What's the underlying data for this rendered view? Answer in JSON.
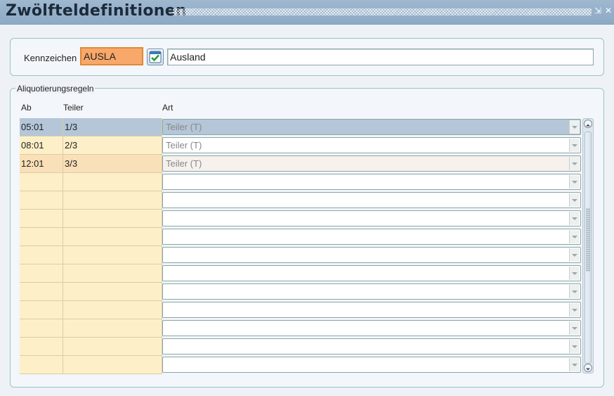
{
  "window": {
    "title": "Zwölfteldefinitionen",
    "minimize_glyph": "⇲",
    "close_glyph": "✕"
  },
  "header": {
    "label": "Kennzeichen",
    "code_value": "AUSLA",
    "name_value": "Ausland",
    "calendar_icon": "calendar-check-icon"
  },
  "rules": {
    "group_title": "Aliquotierungsregeln",
    "columns": {
      "ab": "Ab",
      "teiler": "Teiler",
      "art": "Art"
    },
    "rows": [
      {
        "ab": "05:01",
        "teiler": "1/3",
        "art": "Teiler (T)"
      },
      {
        "ab": "08:01",
        "teiler": "2/3",
        "art": "Teiler (T)"
      },
      {
        "ab": "12:01",
        "teiler": "3/3",
        "art": "Teiler (T)"
      },
      {
        "ab": "",
        "teiler": "",
        "art": ""
      },
      {
        "ab": "",
        "teiler": "",
        "art": ""
      },
      {
        "ab": "",
        "teiler": "",
        "art": ""
      },
      {
        "ab": "",
        "teiler": "",
        "art": ""
      },
      {
        "ab": "",
        "teiler": "",
        "art": ""
      },
      {
        "ab": "",
        "teiler": "",
        "art": ""
      },
      {
        "ab": "",
        "teiler": "",
        "art": ""
      },
      {
        "ab": "",
        "teiler": "",
        "art": ""
      },
      {
        "ab": "",
        "teiler": "",
        "art": ""
      },
      {
        "ab": "",
        "teiler": "",
        "art": ""
      },
      {
        "ab": "",
        "teiler": "",
        "art": ""
      }
    ]
  },
  "colors": {
    "selected_row": "#b4c6d8",
    "row_bg": "#fdf0c8",
    "highlight_row": "#fae0b8",
    "code_field": "#f8a86a",
    "titlebar": "#9fb8d0"
  }
}
